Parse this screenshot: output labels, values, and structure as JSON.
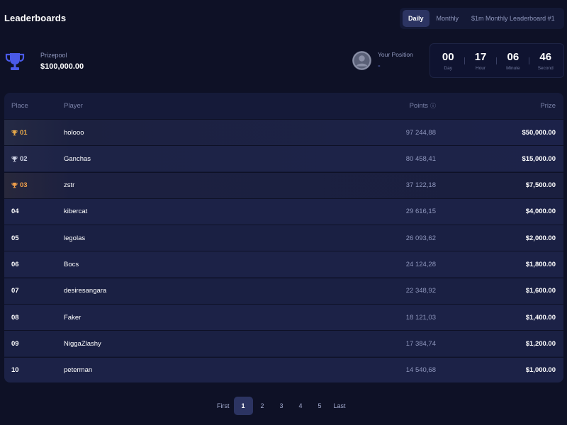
{
  "header": {
    "title": "Leaderboards",
    "tabs": [
      {
        "label": "Daily",
        "active": true
      },
      {
        "label": "Monthly",
        "active": false
      },
      {
        "label": "$1m Monthly Leaderboard #1",
        "active": false
      }
    ]
  },
  "prizepool": {
    "label": "Prizepool",
    "value": "$100,000.00",
    "icon": "trophy-icon",
    "icon_color": "#4a5ae8"
  },
  "your_position": {
    "label": "Your Position",
    "value": "-",
    "icon": "user-avatar-icon"
  },
  "countdown": [
    {
      "value": "00",
      "label": "Day"
    },
    {
      "value": "17",
      "label": "Hour"
    },
    {
      "value": "06",
      "label": "Minute"
    },
    {
      "value": "46",
      "label": "Second"
    }
  ],
  "table": {
    "columns": {
      "place": "Place",
      "player": "Player",
      "points": "Points",
      "prize": "Prize"
    },
    "rows": [
      {
        "place": "01",
        "player": "holooo",
        "points": "97 244,88",
        "prize": "$50,000.00",
        "medal": "gold"
      },
      {
        "place": "02",
        "player": "Ganchas",
        "points": "80 458,41",
        "prize": "$15,000.00",
        "medal": "silver"
      },
      {
        "place": "03",
        "player": "zstr",
        "points": "37 122,18",
        "prize": "$7,500.00",
        "medal": "bronze"
      },
      {
        "place": "04",
        "player": "kibercat",
        "points": "29 616,15",
        "prize": "$4,000.00",
        "medal": ""
      },
      {
        "place": "05",
        "player": "legolas",
        "points": "26 093,62",
        "prize": "$2,000.00",
        "medal": ""
      },
      {
        "place": "06",
        "player": "Bocs",
        "points": "24 124,28",
        "prize": "$1,800.00",
        "medal": ""
      },
      {
        "place": "07",
        "player": "desiresangara",
        "points": "22 348,92",
        "prize": "$1,600.00",
        "medal": ""
      },
      {
        "place": "08",
        "player": "Faker",
        "points": "18 121,03",
        "prize": "$1,400.00",
        "medal": ""
      },
      {
        "place": "09",
        "player": "NiggaZlashy",
        "points": "17 384,74",
        "prize": "$1,200.00",
        "medal": ""
      },
      {
        "place": "10",
        "player": "peterman",
        "points": "14 540,68",
        "prize": "$1,000.00",
        "medal": ""
      }
    ]
  },
  "pagination": {
    "first": "First",
    "pages": [
      "1",
      "2",
      "3",
      "4",
      "5"
    ],
    "current": "1",
    "last": "Last"
  },
  "colors": {
    "background": "#0e1126",
    "panel": "#151a39",
    "accent": "#2c3462",
    "gold": "#e8a94a",
    "silver": "#cfd3e6",
    "bronze": "#f2a04a"
  }
}
